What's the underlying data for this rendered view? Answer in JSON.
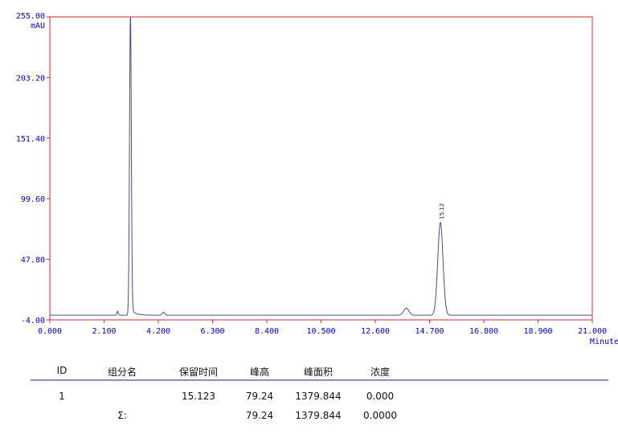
{
  "chart_data": {
    "type": "line",
    "yunit": "mAU",
    "xunit": "Minutes",
    "xlim": [
      0,
      21
    ],
    "ylim": [
      -4,
      255
    ],
    "x_ticks": [
      "0.000",
      "2.100",
      "4.200",
      "6.300",
      "8.400",
      "10.500",
      "12.600",
      "14.700",
      "16.800",
      "18.900",
      "21.000"
    ],
    "y_ticks": [
      "-4.00",
      "47.80",
      "99.60",
      "151.40",
      "203.20",
      "255.00"
    ],
    "baseline": 0,
    "peaks": [
      {
        "rt": 2.62,
        "height": 3.5,
        "width": 0.025
      },
      {
        "rt": 3.12,
        "height": 255,
        "width": 0.035,
        "tail": 0.18
      },
      {
        "rt": 4.4,
        "height": 2.5,
        "width": 0.05
      },
      {
        "rt": 13.8,
        "height": 6,
        "width": 0.1
      },
      {
        "rt": 15.12,
        "height": 79.24,
        "width": 0.1,
        "label": "15.12"
      }
    ],
    "line_color": "#4b4d7a",
    "frame_color": "#e0242b"
  },
  "table": {
    "headers": [
      "ID",
      "组分名",
      "保留时间",
      "峰高",
      "峰面积",
      "浓度"
    ],
    "rows": [
      [
        "1",
        "",
        "15.123",
        "79.24",
        "1379.844",
        "0.000"
      ]
    ],
    "sum_label": "Σ:",
    "sum_height": "79.24",
    "sum_area": "1379.844",
    "sum_conc": "0.0000"
  }
}
